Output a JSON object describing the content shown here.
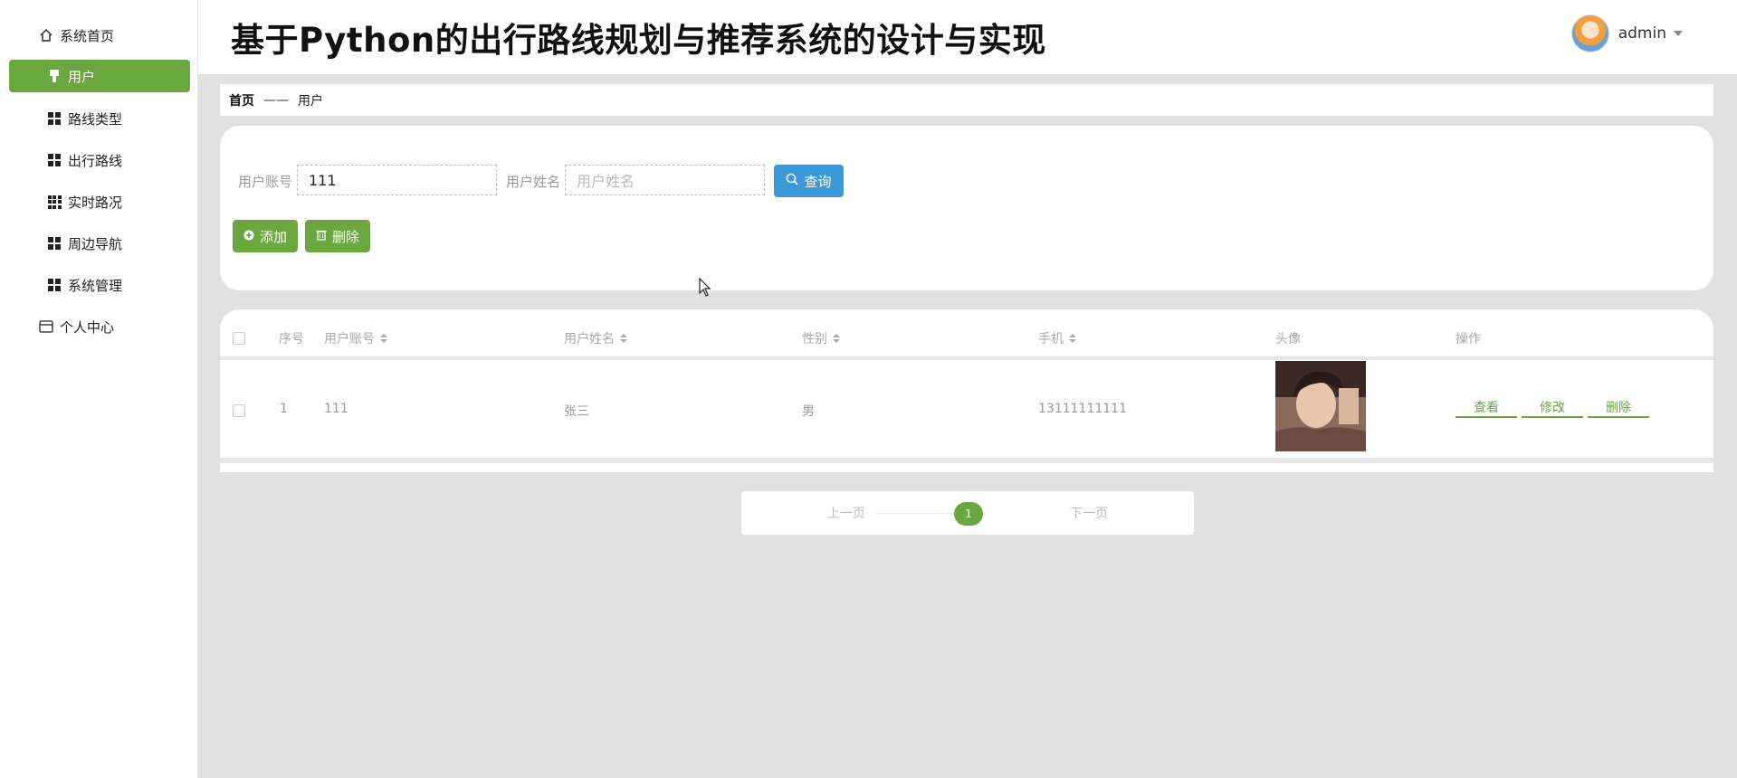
{
  "app": {
    "title": "基于Python的出行路线规划与推荐系统的设计与实现"
  },
  "user": {
    "name": "admin"
  },
  "sidebar": {
    "items": [
      {
        "label": "系统首页",
        "icon": "home-icon"
      },
      {
        "label": "用户",
        "icon": "pin-icon",
        "active": true
      },
      {
        "label": "路线类型",
        "icon": "grid-icon"
      },
      {
        "label": "出行路线",
        "icon": "grid-icon"
      },
      {
        "label": "实时路况",
        "icon": "grid9-icon"
      },
      {
        "label": "周边导航",
        "icon": "grid-icon"
      },
      {
        "label": "系统管理",
        "icon": "grid-icon"
      },
      {
        "label": "个人中心",
        "icon": "card-icon"
      }
    ]
  },
  "breadcrumb": {
    "home": "首页",
    "separator": "——",
    "current": "用户"
  },
  "search": {
    "account_label": "用户账号",
    "account_value": "111",
    "name_label": "用户姓名",
    "name_placeholder": "用户姓名",
    "query_label": "查询",
    "add_label": "添加",
    "delete_label": "删除"
  },
  "table": {
    "columns": [
      "序号",
      "用户账号",
      "用户姓名",
      "性别",
      "手机",
      "头像",
      "操作"
    ],
    "rows": [
      {
        "index": "1",
        "account": "111",
        "name": "张三",
        "gender": "男",
        "phone": "13111111111",
        "actions": [
          "查看",
          "修改",
          "删除"
        ]
      }
    ]
  },
  "pagination": {
    "prev": "上一页",
    "page": "1",
    "next": "下一页"
  },
  "colors": {
    "accent": "#6aa73f",
    "query": "#3a9ad9",
    "background": "#e1e1e1"
  }
}
